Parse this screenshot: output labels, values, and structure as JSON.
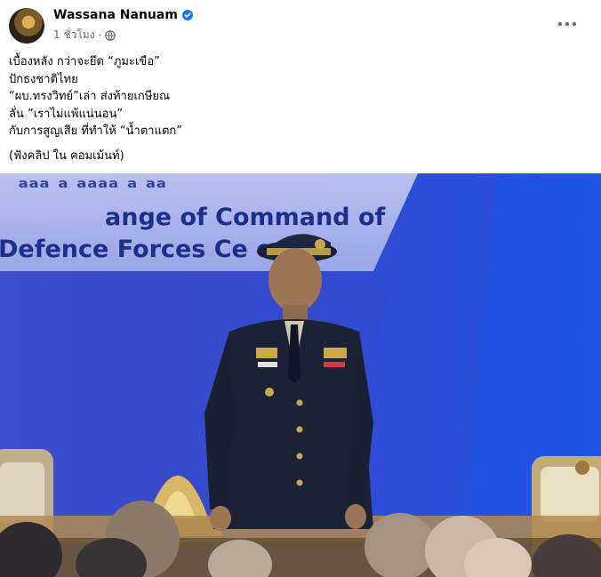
{
  "post": {
    "author": "Wassana Nanuam",
    "timestamp": "1 ชั่วโมง",
    "separator": "·",
    "verified_icon": "verified-badge-icon",
    "privacy_icon": "globe-icon",
    "more_icon": "more-options-icon"
  },
  "text": {
    "line1": "เบื้องหลัง กว่าจะยึด “ภูมะเขือ”",
    "line2": "ปักธงชาติไทย",
    "line3": "“ผบ.ทรงวิทย์”เล่า ส่งท้ายเกษียณ",
    "line4": "ลั่น  ”เราไม่แพ้แน่นอน”",
    "line5": "กับการสูญเสีย  ที่ทำให้ “น้ำตาแตก”",
    "line6": "(ฟังคลิป ใน คอมเม้นท์)"
  },
  "photo": {
    "banner_line1": "ange of Command of",
    "banner_line2": "Defence Forces Ce   ony",
    "colors": {
      "background": "#3146c6",
      "banner_text": "#1c2f8a",
      "uniform": "#1b2236"
    }
  }
}
